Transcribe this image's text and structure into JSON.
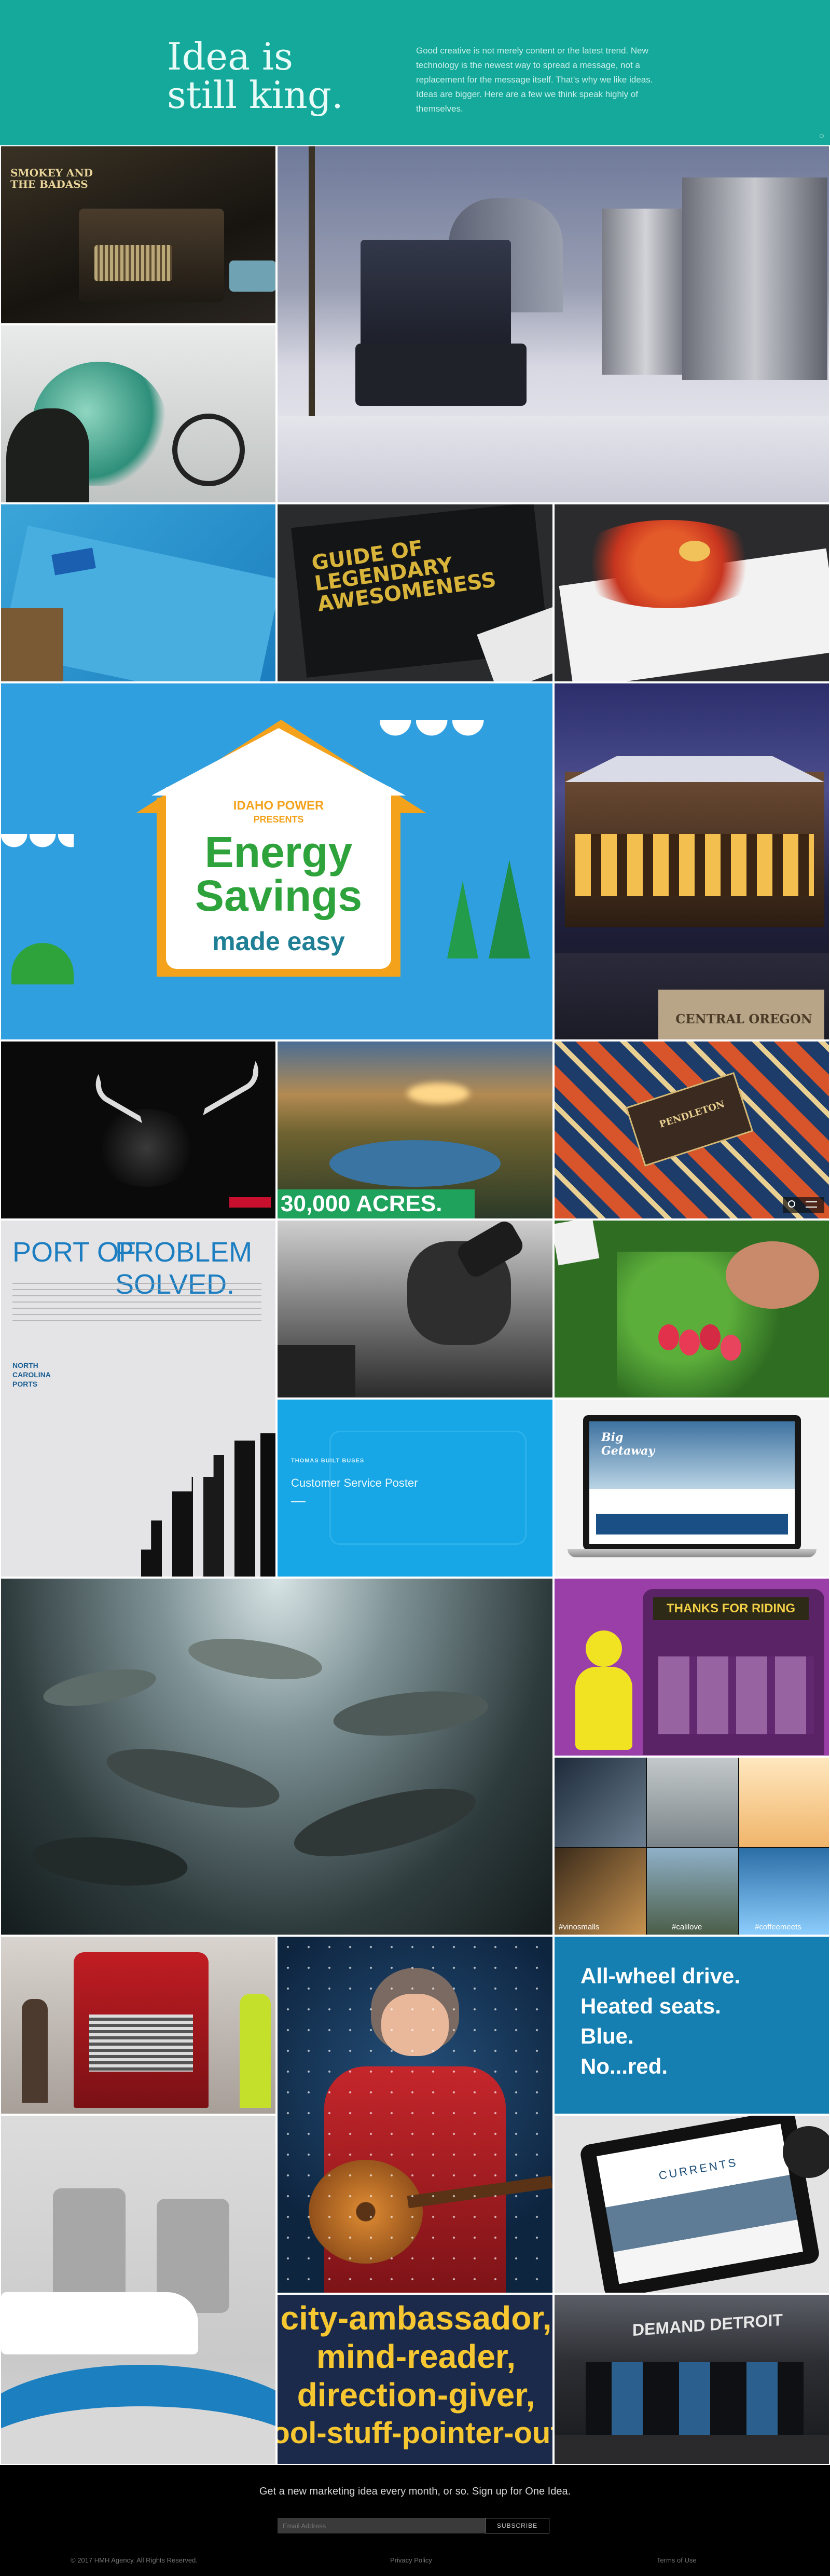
{
  "hero": {
    "title_line1": "Idea is",
    "title_line2": "still king.",
    "text": "Good creative is not merely content or the latest trend. New technology is the newest way to spread a message, not a replacement for the message itself. That's why we like ideas. Ideas are bigger. Here are a few we think speak highly of themselves."
  },
  "tiles": {
    "smokey": "SMOKEY AND THE BADASS",
    "guide": "GUIDE OF LEGENDARY AWESOMENESS",
    "idaho_power": "IDAHO POWER",
    "presents": "PRESENTS",
    "energy": "Energy",
    "savings": "Savings",
    "made_easy": "made easy",
    "central_oregon": "CENTRAL OREGON",
    "acres": "30,000 ACRES.",
    "pendleton": "PENDLETON",
    "port_of": "PORT OF",
    "problem_solved": "PROBLEM SOLVED.",
    "nc_ports": "NORTH CAROLINA PORTS",
    "csp_small": "THOMAS BUILT BUSES",
    "csp_title": "Customer Service Poster",
    "getaway": "Big Getaway",
    "thanks": "THANKS FOR RIDING",
    "vinos": "#vinosmalls",
    "cally": "#calilove",
    "coffee": "#coffeemeets",
    "allwheel_1": "All-wheel drive.",
    "allwheel_2": "Heated seats.",
    "allwheel_3": "Blue.",
    "allwheel_4": "No...red.",
    "currents": "CURRENTS",
    "city_1": "city-ambassador,",
    "city_2": "mind-reader,",
    "city_3": "direction-giver,",
    "city_4": "ool-stuff-pointer-out",
    "detroit": "DEMAND DETROIT"
  },
  "footer": {
    "signup": "Get a new marketing idea every month, or so. Sign up for One Idea.",
    "email_placeholder": "Email Address",
    "subscribe": "SUBSCRIBE",
    "copyright": "© 2017 HMH Agency. All Rights Reserved.",
    "privacy": "Privacy Policy",
    "terms": "Terms of Use"
  }
}
